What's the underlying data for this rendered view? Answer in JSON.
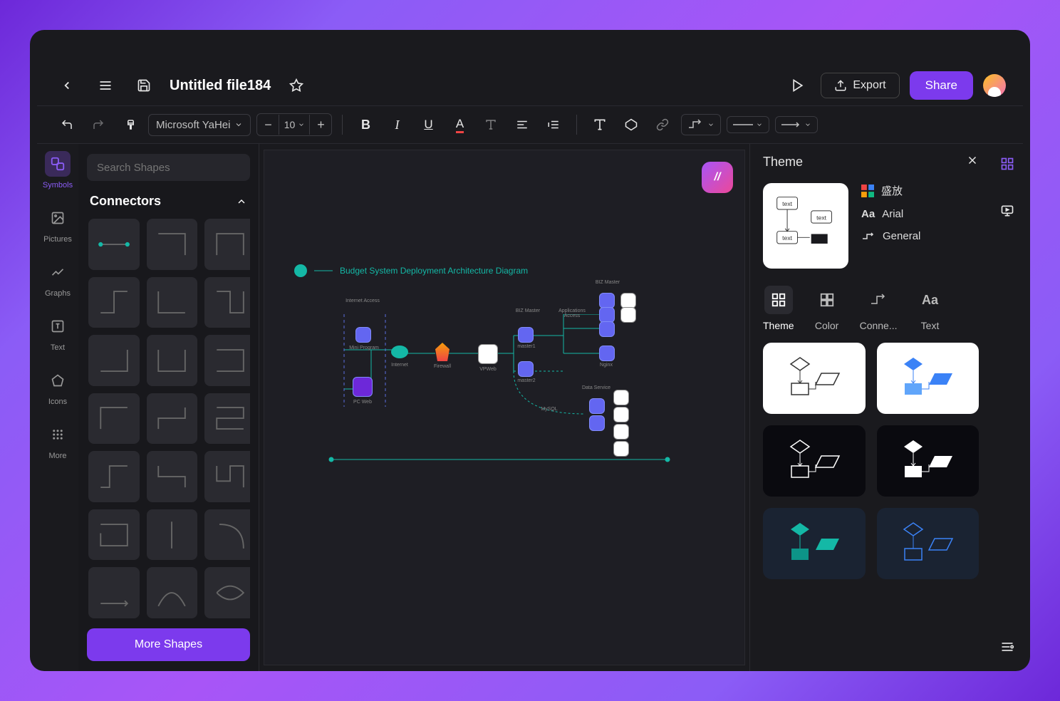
{
  "titlebar": {
    "title": "Untitled file184",
    "export": "Export",
    "share": "Share"
  },
  "toolbar": {
    "font": "Microsoft YaHei",
    "size": "10"
  },
  "sidebar": {
    "items": [
      {
        "label": "Symbols"
      },
      {
        "label": "Pictures"
      },
      {
        "label": "Graphs"
      },
      {
        "label": "Text"
      },
      {
        "label": "Icons"
      },
      {
        "label": "More"
      }
    ]
  },
  "shapes": {
    "search_placeholder": "Search Shapes",
    "section": "Connectors",
    "more": "More Shapes"
  },
  "canvas": {
    "diagram_title": "Budget System Deployment Architecture Diagram",
    "labels": {
      "internet_access": "Internet Access",
      "mini_program": "Mini Program",
      "pc_web": "PC Web",
      "internet": "Internet",
      "firewall": "Firewall",
      "vpweb": "VPWeb",
      "biz_master": "BIZ Master",
      "master1": "master1",
      "master2": "master2",
      "app_access": "Applications Access",
      "data_service": "Data Service",
      "nginx": "Nginx",
      "mysql": "MySQL"
    }
  },
  "theme": {
    "header": "Theme",
    "meta": {
      "color_scheme": "盛放",
      "font": "Arial",
      "connector": "General"
    },
    "tabs": [
      {
        "label": "Theme"
      },
      {
        "label": "Color"
      },
      {
        "label": "Conne..."
      },
      {
        "label": "Text"
      }
    ]
  }
}
